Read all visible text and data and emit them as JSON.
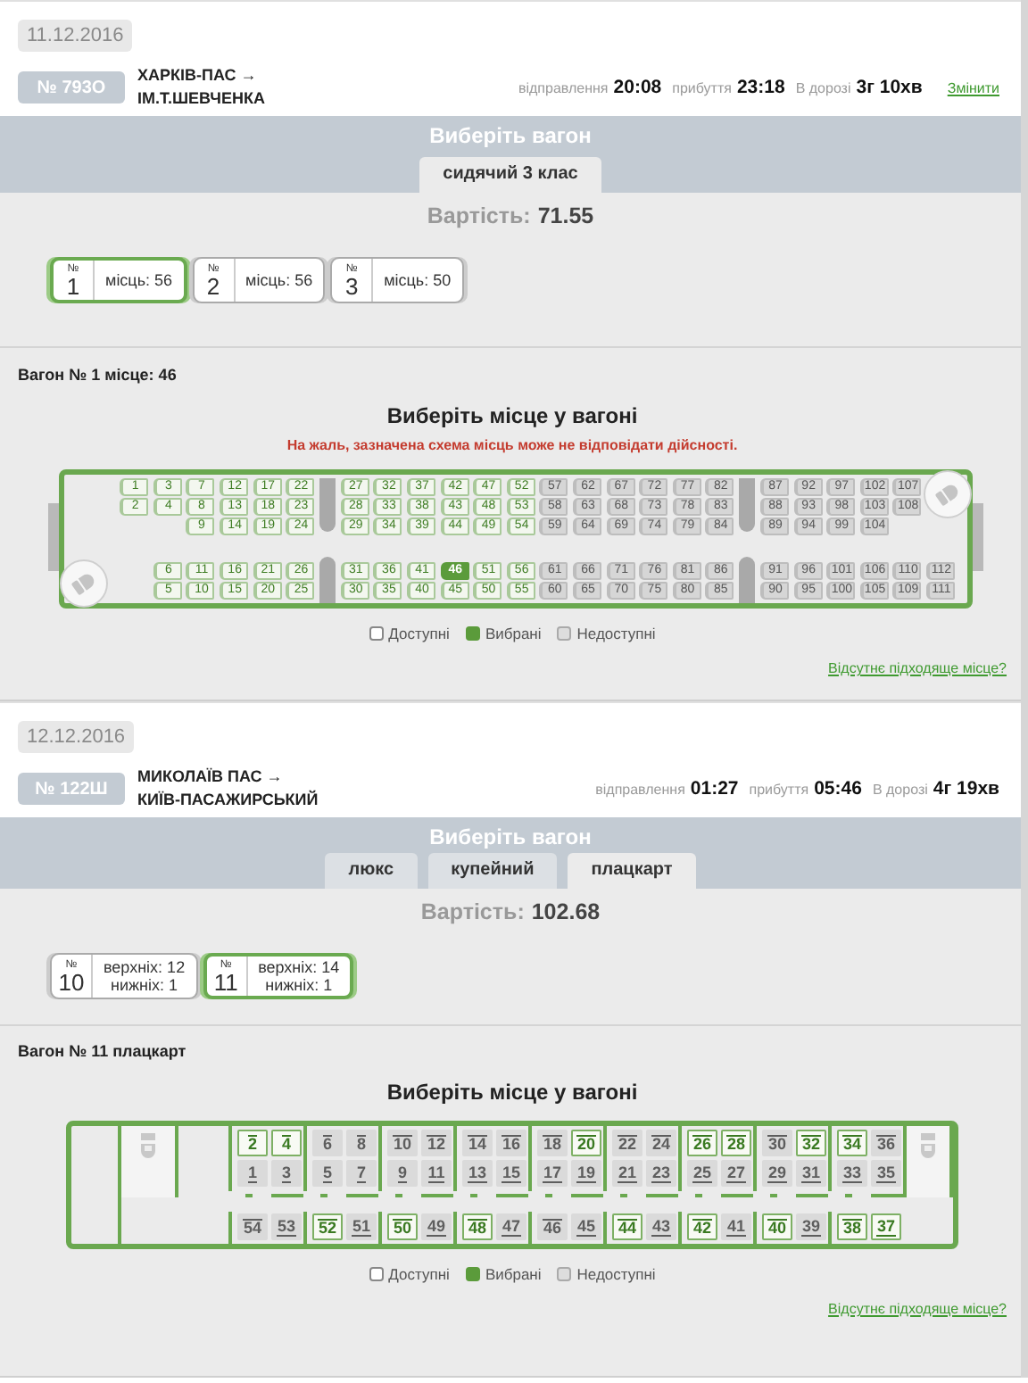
{
  "trips": [
    {
      "date": "11.12.2016",
      "train": "№ 793О",
      "route": [
        "ХАРКІВ-ПАС →",
        "ІМ.Т.ШЕВЧЕНКА"
      ],
      "times": [
        {
          "label": "відправлення",
          "value": "20:08"
        },
        {
          "label": "прибуття",
          "value": "23:18"
        },
        {
          "label": "В дорозі",
          "value": "3г 10хв"
        }
      ],
      "change_link": "Змінити",
      "choose_title": "Виберіть вагон",
      "tabs": [
        {
          "label": "сидячий 3 клас",
          "selected": true
        }
      ],
      "price_label": "Вартість:",
      "price": "71.55",
      "wagons": [
        {
          "no_label": "№",
          "number": "1",
          "lines": [
            "місць: 56"
          ],
          "selected": true
        },
        {
          "no_label": "№",
          "number": "2",
          "lines": [
            "місць: 56"
          ],
          "selected": false
        },
        {
          "no_label": "№",
          "number": "3",
          "lines": [
            "місць: 50"
          ],
          "selected": false
        }
      ],
      "wagon_section": {
        "title": "Вагон № 1 місце: 46",
        "heading": "Виберіть місце у вагоні",
        "warning": "На жаль, зазначена схема місць може не відповідати дійсності.",
        "map": {
          "kind": "seated",
          "columns": [
            {
              "kind": "seats",
              "top": [
                {
                  "n": "1",
                  "available": true,
                  "selected": false
                },
                {
                  "n": "2",
                  "available": true,
                  "selected": false
                }
              ]
            },
            {
              "kind": "seats",
              "top": [
                {
                  "n": "3",
                  "available": true,
                  "selected": false
                },
                {
                  "n": "4",
                  "available": true,
                  "selected": false
                }
              ],
              "bottom": [
                {
                  "n": "6",
                  "available": true,
                  "selected": false
                },
                {
                  "n": "5",
                  "available": true,
                  "selected": false
                }
              ]
            },
            {
              "kind": "seats",
              "top": [
                {
                  "n": "7",
                  "available": true,
                  "selected": false
                },
                {
                  "n": "8",
                  "available": true,
                  "selected": false
                },
                {
                  "n": "9",
                  "available": true,
                  "selected": false
                }
              ],
              "bottom": [
                {
                  "n": "11",
                  "available": true,
                  "selected": false
                },
                {
                  "n": "10",
                  "available": true,
                  "selected": false
                }
              ]
            },
            {
              "kind": "seats",
              "top": [
                {
                  "n": "12",
                  "available": true,
                  "selected": false
                },
                {
                  "n": "13",
                  "available": true,
                  "selected": false
                },
                {
                  "n": "14",
                  "available": true,
                  "selected": false
                }
              ],
              "bottom": [
                {
                  "n": "16",
                  "available": true,
                  "selected": false
                },
                {
                  "n": "15",
                  "available": true,
                  "selected": false
                }
              ]
            },
            {
              "kind": "seats",
              "top": [
                {
                  "n": "17",
                  "available": true,
                  "selected": false
                },
                {
                  "n": "18",
                  "available": true,
                  "selected": false
                },
                {
                  "n": "19",
                  "available": true,
                  "selected": false
                }
              ],
              "bottom": [
                {
                  "n": "21",
                  "available": true,
                  "selected": false
                },
                {
                  "n": "20",
                  "available": true,
                  "selected": false
                }
              ]
            },
            {
              "kind": "seats",
              "top": [
                {
                  "n": "22",
                  "available": true,
                  "selected": false
                },
                {
                  "n": "23",
                  "available": true,
                  "selected": false
                },
                {
                  "n": "24",
                  "available": true,
                  "selected": false
                }
              ],
              "bottom": [
                {
                  "n": "26",
                  "available": true,
                  "selected": false
                },
                {
                  "n": "25",
                  "available": true,
                  "selected": false
                }
              ]
            },
            {
              "kind": "pillar"
            },
            {
              "kind": "seats",
              "top": [
                {
                  "n": "27",
                  "available": true,
                  "selected": false
                },
                {
                  "n": "28",
                  "available": true,
                  "selected": false
                },
                {
                  "n": "29",
                  "available": true,
                  "selected": false
                }
              ],
              "bottom": [
                {
                  "n": "31",
                  "available": true,
                  "selected": false
                },
                {
                  "n": "30",
                  "available": true,
                  "selected": false
                }
              ]
            },
            {
              "kind": "seats",
              "top": [
                {
                  "n": "32",
                  "available": true,
                  "selected": false
                },
                {
                  "n": "33",
                  "available": true,
                  "selected": false
                },
                {
                  "n": "34",
                  "available": true,
                  "selected": false
                }
              ],
              "bottom": [
                {
                  "n": "36",
                  "available": true,
                  "selected": false
                },
                {
                  "n": "35",
                  "available": true,
                  "selected": false
                }
              ]
            },
            {
              "kind": "seats",
              "top": [
                {
                  "n": "37",
                  "available": true,
                  "selected": false
                },
                {
                  "n": "38",
                  "available": true,
                  "selected": false
                },
                {
                  "n": "39",
                  "available": true,
                  "selected": false
                }
              ],
              "bottom": [
                {
                  "n": "41",
                  "available": true,
                  "selected": false
                },
                {
                  "n": "40",
                  "available": true,
                  "selected": false
                }
              ]
            },
            {
              "kind": "seats",
              "top": [
                {
                  "n": "42",
                  "available": true,
                  "selected": false
                },
                {
                  "n": "43",
                  "available": true,
                  "selected": false
                },
                {
                  "n": "44",
                  "available": true,
                  "selected": false
                }
              ],
              "bottom": [
                {
                  "n": "46",
                  "available": true,
                  "selected": true
                },
                {
                  "n": "45",
                  "available": true,
                  "selected": false
                }
              ]
            },
            {
              "kind": "seats",
              "top": [
                {
                  "n": "47",
                  "available": true,
                  "selected": false
                },
                {
                  "n": "48",
                  "available": true,
                  "selected": false
                },
                {
                  "n": "49",
                  "available": true,
                  "selected": false
                }
              ],
              "bottom": [
                {
                  "n": "51",
                  "available": true,
                  "selected": false
                },
                {
                  "n": "50",
                  "available": true,
                  "selected": false
                }
              ]
            },
            {
              "kind": "seats",
              "top": [
                {
                  "n": "52",
                  "available": true,
                  "selected": false
                },
                {
                  "n": "53",
                  "available": true,
                  "selected": false
                },
                {
                  "n": "54",
                  "available": true,
                  "selected": false
                }
              ],
              "bottom": [
                {
                  "n": "56",
                  "available": true,
                  "selected": false
                },
                {
                  "n": "55",
                  "available": true,
                  "selected": false
                }
              ]
            },
            {
              "kind": "seats",
              "top": [
                {
                  "n": "57",
                  "available": false,
                  "selected": false
                },
                {
                  "n": "58",
                  "available": false,
                  "selected": false
                },
                {
                  "n": "59",
                  "available": false,
                  "selected": false
                }
              ],
              "bottom": [
                {
                  "n": "61",
                  "available": false,
                  "selected": false
                },
                {
                  "n": "60",
                  "available": false,
                  "selected": false
                }
              ]
            },
            {
              "kind": "seats",
              "top": [
                {
                  "n": "62",
                  "available": false,
                  "selected": false
                },
                {
                  "n": "63",
                  "available": false,
                  "selected": false
                },
                {
                  "n": "64",
                  "available": false,
                  "selected": false
                }
              ],
              "bottom": [
                {
                  "n": "66",
                  "available": false,
                  "selected": false
                },
                {
                  "n": "65",
                  "available": false,
                  "selected": false
                }
              ]
            },
            {
              "kind": "seats",
              "top": [
                {
                  "n": "67",
                  "available": false,
                  "selected": false
                },
                {
                  "n": "68",
                  "available": false,
                  "selected": false
                },
                {
                  "n": "69",
                  "available": false,
                  "selected": false
                }
              ],
              "bottom": [
                {
                  "n": "71",
                  "available": false,
                  "selected": false
                },
                {
                  "n": "70",
                  "available": false,
                  "selected": false
                }
              ]
            },
            {
              "kind": "seats",
              "top": [
                {
                  "n": "72",
                  "available": false,
                  "selected": false
                },
                {
                  "n": "73",
                  "available": false,
                  "selected": false
                },
                {
                  "n": "74",
                  "available": false,
                  "selected": false
                }
              ],
              "bottom": [
                {
                  "n": "76",
                  "available": false,
                  "selected": false
                },
                {
                  "n": "75",
                  "available": false,
                  "selected": false
                }
              ]
            },
            {
              "kind": "seats",
              "top": [
                {
                  "n": "77",
                  "available": false,
                  "selected": false
                },
                {
                  "n": "78",
                  "available": false,
                  "selected": false
                },
                {
                  "n": "79",
                  "available": false,
                  "selected": false
                }
              ],
              "bottom": [
                {
                  "n": "81",
                  "available": false,
                  "selected": false
                },
                {
                  "n": "80",
                  "available": false,
                  "selected": false
                }
              ]
            },
            {
              "kind": "seats",
              "top": [
                {
                  "n": "82",
                  "available": false,
                  "selected": false
                },
                {
                  "n": "83",
                  "available": false,
                  "selected": false
                },
                {
                  "n": "84",
                  "available": false,
                  "selected": false
                }
              ],
              "bottom": [
                {
                  "n": "86",
                  "available": false,
                  "selected": false
                },
                {
                  "n": "85",
                  "available": false,
                  "selected": false
                }
              ]
            },
            {
              "kind": "pillar"
            },
            {
              "kind": "seats",
              "top": [
                {
                  "n": "87",
                  "available": false,
                  "selected": false
                },
                {
                  "n": "88",
                  "available": false,
                  "selected": false
                },
                {
                  "n": "89",
                  "available": false,
                  "selected": false
                }
              ],
              "bottom": [
                {
                  "n": "91",
                  "available": false,
                  "selected": false
                },
                {
                  "n": "90",
                  "available": false,
                  "selected": false
                }
              ]
            },
            {
              "kind": "seats",
              "top": [
                {
                  "n": "92",
                  "available": false,
                  "selected": false
                },
                {
                  "n": "93",
                  "available": false,
                  "selected": false
                },
                {
                  "n": "94",
                  "available": false,
                  "selected": false
                }
              ],
              "bottom": [
                {
                  "n": "96",
                  "available": false,
                  "selected": false
                },
                {
                  "n": "95",
                  "available": false,
                  "selected": false
                }
              ]
            },
            {
              "kind": "seats",
              "top": [
                {
                  "n": "97",
                  "available": false,
                  "selected": false
                },
                {
                  "n": "98",
                  "available": false,
                  "selected": false
                },
                {
                  "n": "99",
                  "available": false,
                  "selected": false
                }
              ],
              "bottom": [
                {
                  "n": "101",
                  "available": false,
                  "selected": false
                },
                {
                  "n": "100",
                  "available": false,
                  "selected": false
                }
              ]
            },
            {
              "kind": "seats",
              "top": [
                {
                  "n": "102",
                  "available": false,
                  "selected": false
                },
                {
                  "n": "103",
                  "available": false,
                  "selected": false
                },
                {
                  "n": "104",
                  "available": false,
                  "selected": false
                }
              ],
              "bottom": [
                {
                  "n": "106",
                  "available": false,
                  "selected": false
                },
                {
                  "n": "105",
                  "available": false,
                  "selected": false
                }
              ]
            },
            {
              "kind": "seats",
              "top": [
                {
                  "n": "107",
                  "available": false,
                  "selected": false
                },
                {
                  "n": "108",
                  "available": false,
                  "selected": false
                }
              ],
              "bottom": [
                {
                  "n": "110",
                  "available": false,
                  "selected": false
                },
                {
                  "n": "109",
                  "available": false,
                  "selected": false
                }
              ]
            },
            {
              "kind": "seats",
              "bottom": [
                {
                  "n": "112",
                  "available": false,
                  "selected": false
                },
                {
                  "n": "111",
                  "available": false,
                  "selected": false
                }
              ]
            }
          ]
        },
        "legend": [
          {
            "label": "Доступні",
            "kind": "available"
          },
          {
            "label": "Вибрані",
            "kind": "selected"
          },
          {
            "label": "Недоступні",
            "kind": "unavailable"
          }
        ],
        "link": "Відсутнє підходяще місце?"
      }
    },
    {
      "date": "12.12.2016",
      "train": "№ 122Ш",
      "route": [
        "МИКОЛАЇВ ПАС →",
        "КИЇВ-ПАСАЖИРСЬКИЙ"
      ],
      "times": [
        {
          "label": "відправлення",
          "value": "01:27"
        },
        {
          "label": "прибуття",
          "value": "05:46"
        },
        {
          "label": "В дорозі",
          "value": "4г 19хв"
        }
      ],
      "choose_title": "Виберіть вагон",
      "tabs": [
        {
          "label": "люкс",
          "selected": false
        },
        {
          "label": "купейний",
          "selected": false
        },
        {
          "label": "плацкарт",
          "selected": true
        }
      ],
      "price_label": "Вартість:",
      "price": "102.68",
      "wagons": [
        {
          "no_label": "№",
          "number": "10",
          "lines": [
            "верхніх: 12",
            "нижніх: 1"
          ],
          "selected": false
        },
        {
          "no_label": "№",
          "number": "11",
          "lines": [
            "верхніх: 14",
            "нижніх: 1"
          ],
          "selected": true
        }
      ],
      "wagon_section": {
        "title": "Вагон № 11 плацкарт",
        "heading": "Виберіть місце у вагоні",
        "map": {
          "kind": "platzkart",
          "compartments": [
            {
              "upper": [
                {
                  "n": "2",
                  "available": true,
                  "selected": false
                },
                {
                  "n": "4",
                  "available": true,
                  "selected": false
                }
              ],
              "lower": [
                {
                  "n": "1",
                  "available": false,
                  "selected": false
                },
                {
                  "n": "3",
                  "available": false,
                  "selected": false
                }
              ],
              "side_upper": {
                "n": "54",
                "available": false,
                "selected": false
              },
              "side_lower": {
                "n": "53",
                "available": false,
                "selected": false
              }
            },
            {
              "upper": [
                {
                  "n": "6",
                  "available": false,
                  "selected": false
                },
                {
                  "n": "8",
                  "available": false,
                  "selected": false
                }
              ],
              "lower": [
                {
                  "n": "5",
                  "available": false,
                  "selected": false
                },
                {
                  "n": "7",
                  "available": false,
                  "selected": false
                }
              ],
              "side_upper": {
                "n": "52",
                "available": true,
                "selected": false
              },
              "side_lower": {
                "n": "51",
                "available": false,
                "selected": false
              }
            },
            {
              "upper": [
                {
                  "n": "10",
                  "available": false,
                  "selected": false
                },
                {
                  "n": "12",
                  "available": false,
                  "selected": false
                }
              ],
              "lower": [
                {
                  "n": "9",
                  "available": false,
                  "selected": false
                },
                {
                  "n": "11",
                  "available": false,
                  "selected": false
                }
              ],
              "side_upper": {
                "n": "50",
                "available": true,
                "selected": false
              },
              "side_lower": {
                "n": "49",
                "available": false,
                "selected": false
              }
            },
            {
              "upper": [
                {
                  "n": "14",
                  "available": false,
                  "selected": false
                },
                {
                  "n": "16",
                  "available": false,
                  "selected": false
                }
              ],
              "lower": [
                {
                  "n": "13",
                  "available": false,
                  "selected": false
                },
                {
                  "n": "15",
                  "available": false,
                  "selected": false
                }
              ],
              "side_upper": {
                "n": "48",
                "available": true,
                "selected": false
              },
              "side_lower": {
                "n": "47",
                "available": false,
                "selected": false
              }
            },
            {
              "upper": [
                {
                  "n": "18",
                  "available": false,
                  "selected": false
                },
                {
                  "n": "20",
                  "available": true,
                  "selected": false
                }
              ],
              "lower": [
                {
                  "n": "17",
                  "available": false,
                  "selected": false
                },
                {
                  "n": "19",
                  "available": false,
                  "selected": false
                }
              ],
              "side_upper": {
                "n": "46",
                "available": false,
                "selected": false
              },
              "side_lower": {
                "n": "45",
                "available": false,
                "selected": false
              }
            },
            {
              "upper": [
                {
                  "n": "22",
                  "available": false,
                  "selected": false
                },
                {
                  "n": "24",
                  "available": false,
                  "selected": false
                }
              ],
              "lower": [
                {
                  "n": "21",
                  "available": false,
                  "selected": false
                },
                {
                  "n": "23",
                  "available": false,
                  "selected": false
                }
              ],
              "side_upper": {
                "n": "44",
                "available": true,
                "selected": false
              },
              "side_lower": {
                "n": "43",
                "available": false,
                "selected": false
              }
            },
            {
              "upper": [
                {
                  "n": "26",
                  "available": true,
                  "selected": false
                },
                {
                  "n": "28",
                  "available": true,
                  "selected": false
                }
              ],
              "lower": [
                {
                  "n": "25",
                  "available": false,
                  "selected": false
                },
                {
                  "n": "27",
                  "available": false,
                  "selected": false
                }
              ],
              "side_upper": {
                "n": "42",
                "available": true,
                "selected": false
              },
              "side_lower": {
                "n": "41",
                "available": false,
                "selected": false
              }
            },
            {
              "upper": [
                {
                  "n": "30",
                  "available": false,
                  "selected": false
                },
                {
                  "n": "32",
                  "available": true,
                  "selected": false
                }
              ],
              "lower": [
                {
                  "n": "29",
                  "available": false,
                  "selected": false
                },
                {
                  "n": "31",
                  "available": false,
                  "selected": false
                }
              ],
              "side_upper": {
                "n": "40",
                "available": true,
                "selected": false
              },
              "side_lower": {
                "n": "39",
                "available": false,
                "selected": false
              }
            },
            {
              "upper": [
                {
                  "n": "34",
                  "available": true,
                  "selected": false
                },
                {
                  "n": "36",
                  "available": false,
                  "selected": false
                }
              ],
              "lower": [
                {
                  "n": "33",
                  "available": false,
                  "selected": false
                },
                {
                  "n": "35",
                  "available": false,
                  "selected": false
                }
              ],
              "side_upper": {
                "n": "38",
                "available": true,
                "selected": false
              },
              "side_lower": {
                "n": "37",
                "available": true,
                "selected": false
              }
            }
          ]
        },
        "legend": [
          {
            "label": "Доступні",
            "kind": "available"
          },
          {
            "label": "Вибрані",
            "kind": "selected"
          },
          {
            "label": "Недоступні",
            "kind": "unavailable"
          }
        ],
        "link": "Відсутнє підходяще місце?"
      }
    }
  ]
}
